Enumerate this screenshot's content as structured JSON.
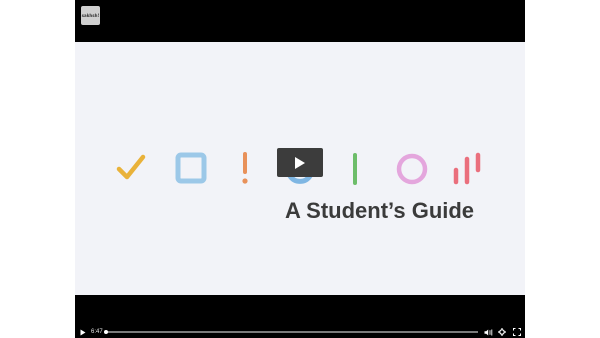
{
  "logo": {
    "text": "sakhsh!"
  },
  "slide": {
    "title": "A Student’s Guide",
    "icons": [
      "check-icon",
      "square-icon",
      "exclamation-icon",
      "rotate-arrows-icon",
      "bar-icon",
      "circle-icon",
      "bars-chart-icon"
    ]
  },
  "controls": {
    "time": "6:47",
    "progress": 0.0,
    "play_icon": "play-icon",
    "volume_icon": "volume-icon",
    "settings_icon": "gear-icon",
    "fullscreen_icon": "fullscreen-icon"
  },
  "colors": {
    "check": "#e9b23a",
    "square": "#9cc8e8",
    "exclamation": "#e8915a",
    "arrows": "#7fb6e3",
    "bar": "#6dbd6a",
    "circle": "#e4a6dd",
    "bars": "#ea6f7d",
    "title": "#3b3b3b"
  }
}
